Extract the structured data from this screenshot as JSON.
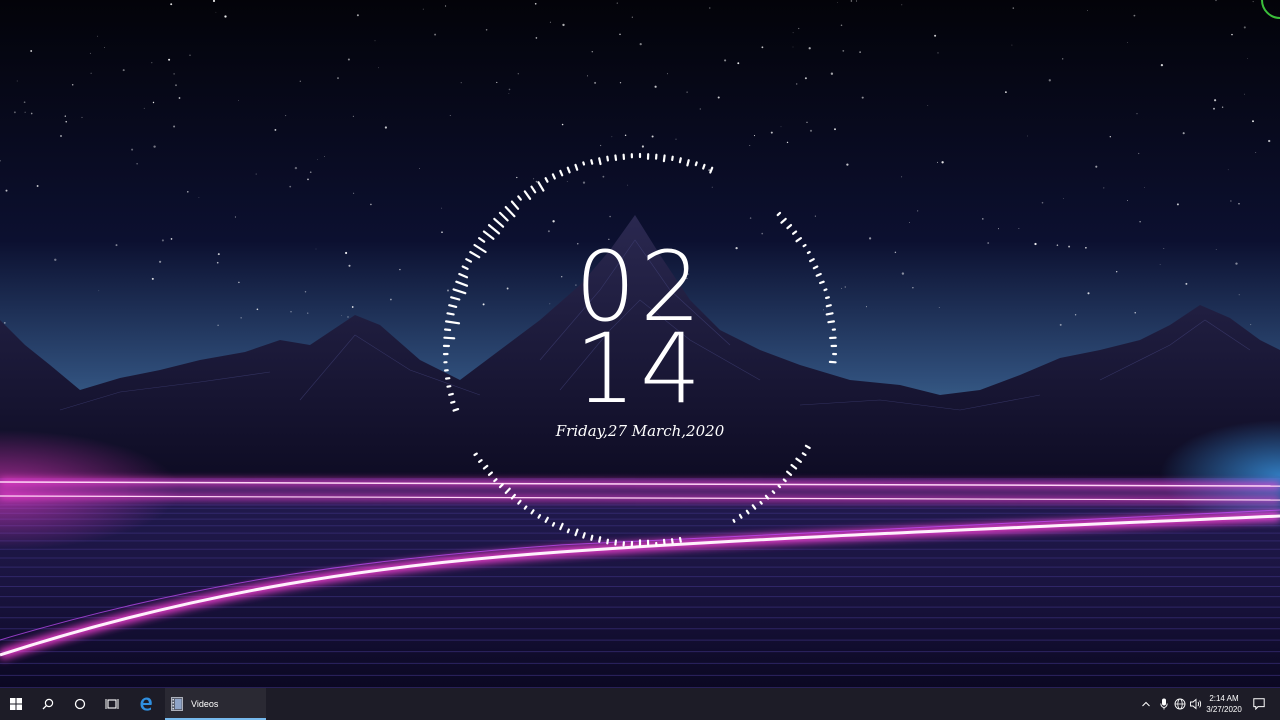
{
  "clock": {
    "hours": "02",
    "minutes": "14",
    "date": "Friday,27 March,2020"
  },
  "taskbar": {
    "start_icon": "windows-logo-icon",
    "search_icon": "search-icon",
    "cortana_icon": "cortana-circle-icon",
    "taskview_icon": "task-view-icon",
    "edge_icon": "edge-browser-icon",
    "apps": [
      {
        "label": "Videos",
        "icon": "film-icon",
        "active": true
      }
    ]
  },
  "tray": {
    "icons": [
      "chevron-up-icon",
      "microphone-icon",
      "network-globe-icon",
      "volume-icon",
      "action-center-icon"
    ],
    "time": "2:14 AM",
    "date": "3/27/2020"
  },
  "colors": {
    "accent_pink": "#ff3fd8",
    "accent_blue": "#3fa9ff",
    "taskbar_bg": "#1d1c27",
    "active_underline": "#76b9ed"
  }
}
